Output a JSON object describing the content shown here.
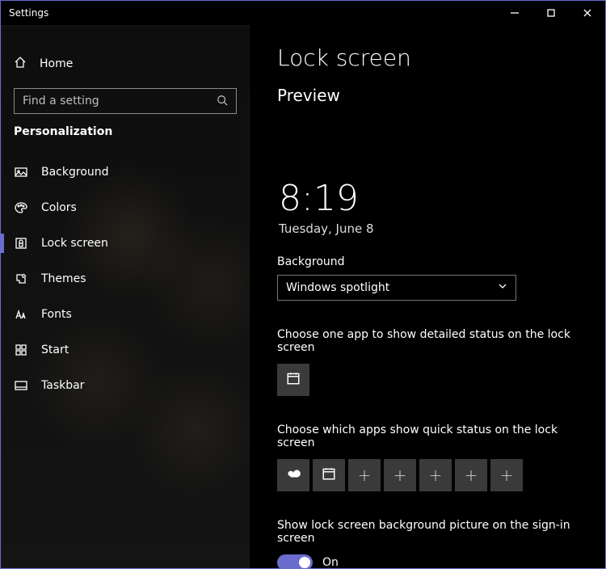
{
  "window": {
    "title": "Settings"
  },
  "sidebar": {
    "home": "Home",
    "search_placeholder": "Find a setting",
    "category": "Personalization",
    "items": [
      {
        "label": "Background"
      },
      {
        "label": "Colors"
      },
      {
        "label": "Lock screen"
      },
      {
        "label": "Themes"
      },
      {
        "label": "Fonts"
      },
      {
        "label": "Start"
      },
      {
        "label": "Taskbar"
      }
    ]
  },
  "main": {
    "title": "Lock screen",
    "preview_heading": "Preview",
    "preview_time": "8:19",
    "preview_date": "Tuesday, June 8",
    "bg_label": "Background",
    "bg_value": "Windows spotlight",
    "detailed_label": "Choose one app to show detailed status on the lock screen",
    "quick_label": "Choose which apps show quick status on the lock screen",
    "signin_label": "Show lock screen background picture on the sign-in screen",
    "signin_state": "On"
  }
}
